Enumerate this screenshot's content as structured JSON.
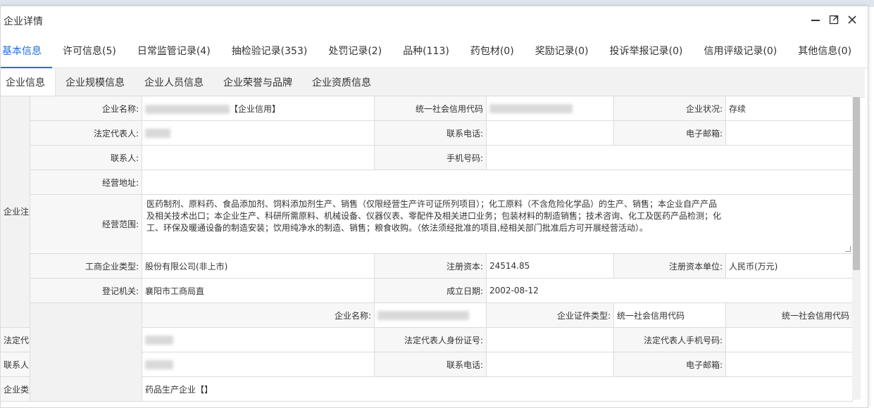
{
  "modal": {
    "title": "企业详情"
  },
  "main_tabs": [
    {
      "label": "基本信息"
    },
    {
      "label": "许可信息(5)"
    },
    {
      "label": "日常监管记录(4)"
    },
    {
      "label": "抽检验记录(353)"
    },
    {
      "label": "处罚记录(2)"
    },
    {
      "label": "品种(113)"
    },
    {
      "label": "药包材(0)"
    },
    {
      "label": "奖励记录(0)"
    },
    {
      "label": "投诉举报记录(0)"
    },
    {
      "label": "信用评级记录(0)"
    },
    {
      "label": "其他信息(0)"
    }
  ],
  "sub_tabs": [
    {
      "label": "企业信息"
    },
    {
      "label": "企业规模信息"
    },
    {
      "label": "企业人员信息"
    },
    {
      "label": "企业荣誉与品牌"
    },
    {
      "label": "企业资质信息"
    }
  ],
  "section1": {
    "group": "企业注册信息",
    "company_name_label": "企业名称:",
    "company_name_suffix": "【企业信用】",
    "credit_code_label": "统一社会信用代码",
    "status_label": "企业状况:",
    "status_value": "存续",
    "legal_rep_label": "法定代表人:",
    "phone_label": "联系电话:",
    "email_label": "电子邮箱:",
    "contact_label": "联系人:",
    "mobile_label": "手机号码:",
    "address_label": "经营地址:",
    "scope_label": "经营范围:",
    "scope_value": "医药制剂、原料药、食品添加剂、饲料添加剂生产、销售（仅限经营生产许可证所列项目）；化工原料（不含危险化学品）的生产、销售；本企业自产产品及相关技术出口；本企业生产、科研所需原料、机械设备、仪器仪表、零配件及相关进口业务；包装材料的制造销售；技术咨询、化工及医药产品检测；化工、环保及暖通设备的制造安装；饮用纯净水的制造、销售；粮食收购。（依法须经批准的项目,经相关部门批准后方可开展经营活动）。",
    "biz_type_label": "工商企业类型:",
    "biz_type_value": "股份有限公司(非上市)",
    "capital_label": "注册资本:",
    "capital_value": "24514.85",
    "capital_unit_label": "注册资本单位:",
    "capital_unit_value": "人民币(万元)",
    "authority_label": "登记机关:",
    "authority_value": "襄阳市工商局直",
    "founded_label": "成立日期:",
    "founded_value": "2002-08-12"
  },
  "section2": {
    "company_name_label": "企业名称:",
    "cert_type_label": "企业证件类型:",
    "cert_type_value": "统一社会信用代码",
    "credit_code_label": "统一社会信用代码",
    "legal_rep_label": "法定代表人:",
    "legal_id_label": "法定代表人身份证号:",
    "legal_mobile_label": "法定代表人手机号码:",
    "contact_label": "联系人",
    "phone_label": "联系电话:",
    "email_label": "电子邮箱:",
    "company_type_label": "企业类型:",
    "company_type_value": "药品生产企业【】"
  }
}
